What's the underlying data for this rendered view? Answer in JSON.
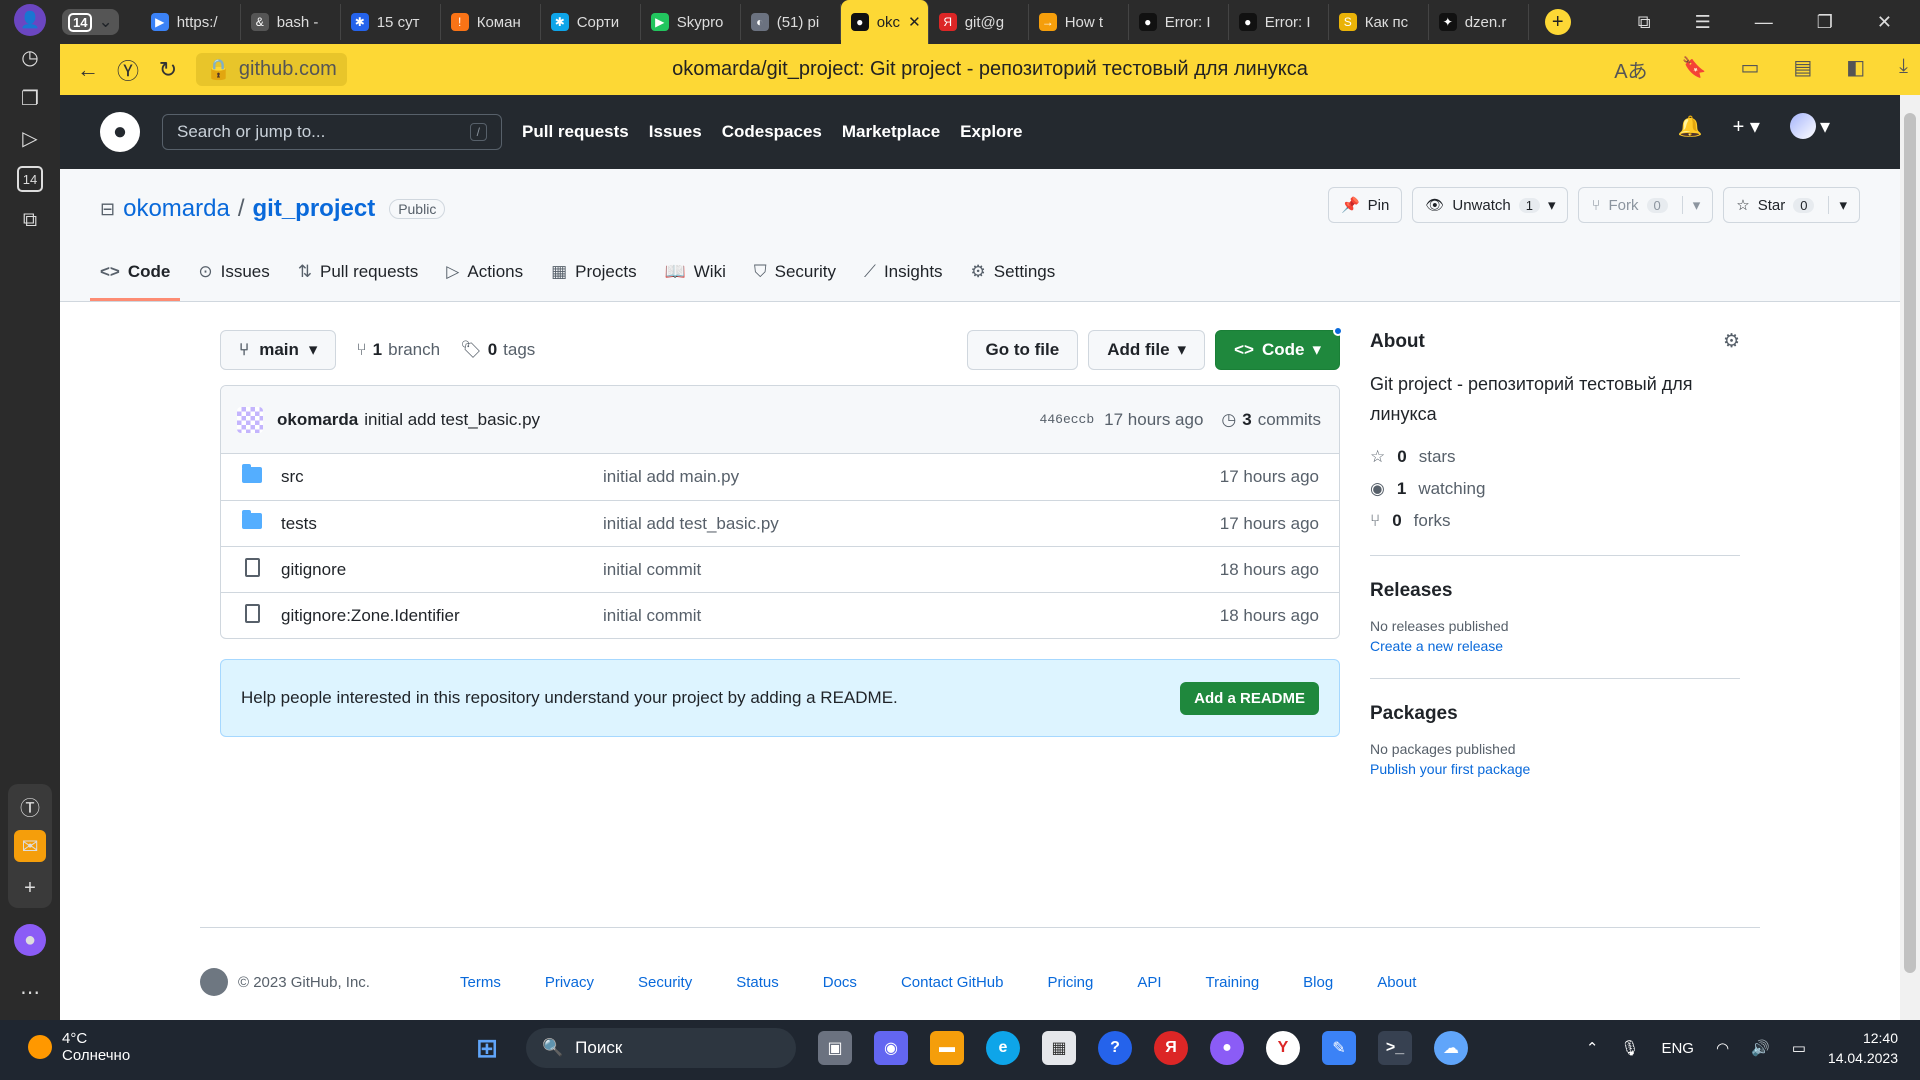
{
  "browser": {
    "tabs": [
      {
        "label": "https:/",
        "color": "#3b82f6",
        "glyph": "▶"
      },
      {
        "label": "bash -",
        "color": "#555",
        "glyph": "&"
      },
      {
        "label": "15 сут",
        "color": "#2563eb",
        "glyph": "✱"
      },
      {
        "label": "Коман",
        "color": "#f97316",
        "glyph": "!"
      },
      {
        "label": "Сорти",
        "color": "#0ea5e9",
        "glyph": "✱"
      },
      {
        "label": "Skypro",
        "color": "#22c55e",
        "glyph": "▶"
      },
      {
        "label": "(51) pi",
        "color": "#6b7280",
        "glyph": "◐"
      },
      {
        "label": "okc",
        "color": "#111",
        "glyph": "●",
        "active": true
      },
      {
        "label": "git@g",
        "color": "#dc2626",
        "glyph": "Я"
      },
      {
        "label": "How t",
        "color": "#f59e0b",
        "glyph": "→"
      },
      {
        "label": "Error: I",
        "color": "#111",
        "glyph": "●"
      },
      {
        "label": "Error: I",
        "color": "#111",
        "glyph": "●"
      },
      {
        "label": "Как пс",
        "color": "#eab308",
        "glyph": "S"
      },
      {
        "label": "dzen.r",
        "color": "#111",
        "glyph": "✦"
      }
    ],
    "tab_count": "14",
    "rail_badge": "14",
    "address_domain": "github.com",
    "page_title": "okomarda/git_project: Git project - репозиторий тестовый для линукса"
  },
  "github": {
    "search_placeholder": "Search or jump to...",
    "search_shortcut": "/",
    "nav": [
      "Pull requests",
      "Issues",
      "Codespaces",
      "Marketplace",
      "Explore"
    ],
    "owner": "okomarda",
    "separator": "/",
    "repo": "git_project",
    "visibility": "Public",
    "actions": {
      "pin": "Pin",
      "unwatch": "Unwatch",
      "watch_count": "1",
      "fork": "Fork",
      "fork_count": "0",
      "star": "Star",
      "star_count": "0"
    },
    "tabs": [
      "Code",
      "Issues",
      "Pull requests",
      "Actions",
      "Projects",
      "Wiki",
      "Security",
      "Insights",
      "Settings"
    ],
    "tab_icons": [
      "<>",
      "⊙",
      "⇅",
      "▷",
      "▦",
      "📖",
      "⛉",
      "⟋",
      "⚙"
    ]
  },
  "toolbar": {
    "branch": "main",
    "branch_count": "1",
    "branch_label": "branch",
    "tag_count": "0",
    "tag_label": "tags",
    "go_to_file": "Go to file",
    "add_file": "Add file",
    "code": "Code"
  },
  "commit": {
    "author": "okomarda",
    "message": "initial add test_basic.py",
    "sha": "446eccb",
    "time": "17 hours ago",
    "commit_count": "3",
    "commits_label": "commits"
  },
  "files": [
    {
      "type": "dir",
      "name": "src",
      "message": "initial add main.py",
      "time": "17 hours ago"
    },
    {
      "type": "dir",
      "name": "tests",
      "message": "initial add test_basic.py",
      "time": "17 hours ago"
    },
    {
      "type": "file",
      "name": "gitignore",
      "message": "initial commit",
      "time": "18 hours ago"
    },
    {
      "type": "file",
      "name": "gitignore:Zone.Identifier",
      "message": "initial commit",
      "time": "18 hours ago"
    }
  ],
  "readme": {
    "text": "Help people interested in this repository understand your project by adding a README.",
    "button": "Add a README"
  },
  "about": {
    "heading": "About",
    "description": "Git project - репозиторий тестовый для линукса",
    "stars_count": "0",
    "stars_label": "stars",
    "watching_count": "1",
    "watching_label": "watching",
    "forks_count": "0",
    "forks_label": "forks",
    "releases_heading": "Releases",
    "releases_text": "No releases published",
    "releases_link": "Create a new release",
    "packages_heading": "Packages",
    "packages_text": "No packages published",
    "packages_link": "Publish your first package"
  },
  "footer": {
    "copyright": "© 2023 GitHub, Inc.",
    "links": [
      "Terms",
      "Privacy",
      "Security",
      "Status",
      "Docs",
      "Contact GitHub",
      "Pricing",
      "API",
      "Training",
      "Blog",
      "About"
    ]
  },
  "taskbar": {
    "temp": "4°C",
    "weather": "Солнечно",
    "search": "Поиск",
    "lang": "ENG",
    "time": "12:40",
    "date": "14.04.2023"
  }
}
